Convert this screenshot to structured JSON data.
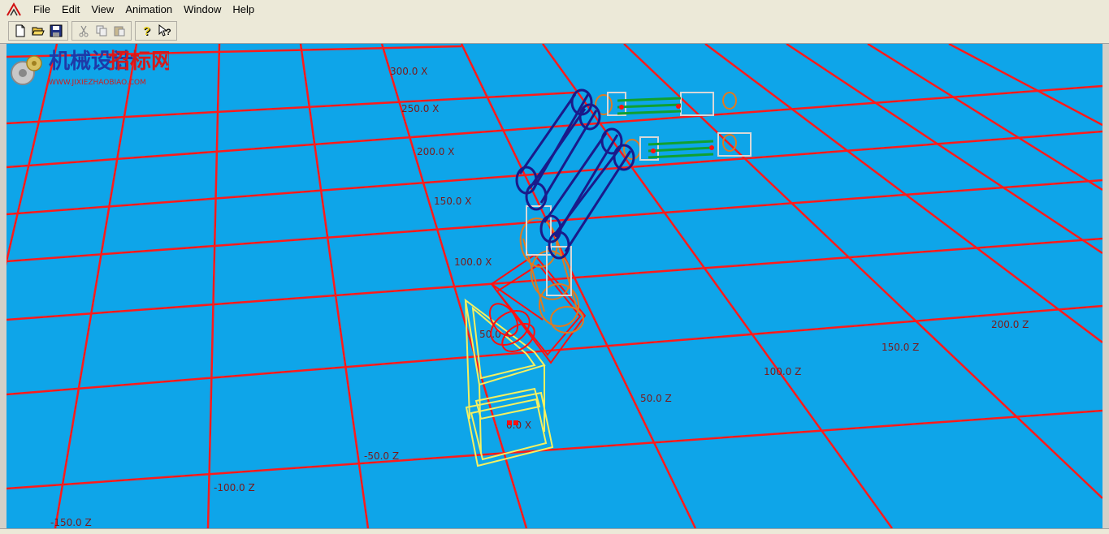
{
  "menu": {
    "items": [
      {
        "label": "File"
      },
      {
        "label": "Edit"
      },
      {
        "label": "View"
      },
      {
        "label": "Animation"
      },
      {
        "label": "Window"
      },
      {
        "label": "Help"
      }
    ]
  },
  "toolbar": {
    "buttons": [
      {
        "icon": "new-document-icon"
      },
      {
        "icon": "open-folder-icon"
      },
      {
        "icon": "save-disk-icon"
      },
      {
        "icon": "cut-scissors-icon"
      },
      {
        "icon": "copy-icon"
      },
      {
        "icon": "paste-icon"
      },
      {
        "icon": "help-icon"
      },
      {
        "icon": "context-help-icon"
      }
    ]
  },
  "viewport": {
    "background_color": "#0ea5e9",
    "grid_color": "#ff1a1a",
    "x_axis_labels": [
      "300.0 X",
      "250.0 X",
      "200.0 X",
      "150.0 X",
      "100.0 X",
      "50.0 X",
      "0.0 X"
    ],
    "z_axis_labels": [
      "200.0 Z",
      "150.0 Z",
      "100.0 Z",
      "50.0 Z",
      "-50.0 Z",
      "-100.0 Z",
      "-150.0 Z"
    ]
  },
  "watermark": {
    "title_a": "机械设计",
    "title_b": "招标网",
    "url": "WWW.JIXIEZHAOBIAO.COM"
  }
}
